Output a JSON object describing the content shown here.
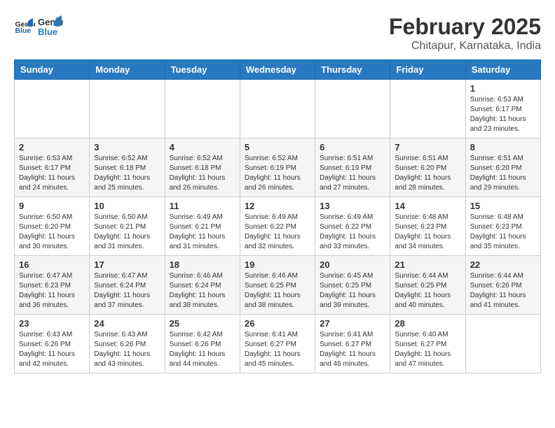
{
  "header": {
    "logo_text_general": "General",
    "logo_text_blue": "Blue",
    "month_year": "February 2025",
    "location": "Chitapur, Karnataka, India"
  },
  "calendar": {
    "days_of_week": [
      "Sunday",
      "Monday",
      "Tuesday",
      "Wednesday",
      "Thursday",
      "Friday",
      "Saturday"
    ],
    "weeks": [
      [
        {
          "day": "",
          "info": ""
        },
        {
          "day": "",
          "info": ""
        },
        {
          "day": "",
          "info": ""
        },
        {
          "day": "",
          "info": ""
        },
        {
          "day": "",
          "info": ""
        },
        {
          "day": "",
          "info": ""
        },
        {
          "day": "1",
          "info": "Sunrise: 6:53 AM\nSunset: 6:17 PM\nDaylight: 11 hours\nand 23 minutes."
        }
      ],
      [
        {
          "day": "2",
          "info": "Sunrise: 6:53 AM\nSunset: 6:17 PM\nDaylight: 11 hours\nand 24 minutes."
        },
        {
          "day": "3",
          "info": "Sunrise: 6:52 AM\nSunset: 6:18 PM\nDaylight: 11 hours\nand 25 minutes."
        },
        {
          "day": "4",
          "info": "Sunrise: 6:52 AM\nSunset: 6:18 PM\nDaylight: 11 hours\nand 26 minutes."
        },
        {
          "day": "5",
          "info": "Sunrise: 6:52 AM\nSunset: 6:19 PM\nDaylight: 11 hours\nand 26 minutes."
        },
        {
          "day": "6",
          "info": "Sunrise: 6:51 AM\nSunset: 6:19 PM\nDaylight: 11 hours\nand 27 minutes."
        },
        {
          "day": "7",
          "info": "Sunrise: 6:51 AM\nSunset: 6:20 PM\nDaylight: 11 hours\nand 28 minutes."
        },
        {
          "day": "8",
          "info": "Sunrise: 6:51 AM\nSunset: 6:20 PM\nDaylight: 11 hours\nand 29 minutes."
        }
      ],
      [
        {
          "day": "9",
          "info": "Sunrise: 6:50 AM\nSunset: 6:20 PM\nDaylight: 11 hours\nand 30 minutes."
        },
        {
          "day": "10",
          "info": "Sunrise: 6:50 AM\nSunset: 6:21 PM\nDaylight: 11 hours\nand 31 minutes."
        },
        {
          "day": "11",
          "info": "Sunrise: 6:49 AM\nSunset: 6:21 PM\nDaylight: 11 hours\nand 31 minutes."
        },
        {
          "day": "12",
          "info": "Sunrise: 6:49 AM\nSunset: 6:22 PM\nDaylight: 11 hours\nand 32 minutes."
        },
        {
          "day": "13",
          "info": "Sunrise: 6:49 AM\nSunset: 6:22 PM\nDaylight: 11 hours\nand 33 minutes."
        },
        {
          "day": "14",
          "info": "Sunrise: 6:48 AM\nSunset: 6:23 PM\nDaylight: 11 hours\nand 34 minutes."
        },
        {
          "day": "15",
          "info": "Sunrise: 6:48 AM\nSunset: 6:23 PM\nDaylight: 11 hours\nand 35 minutes."
        }
      ],
      [
        {
          "day": "16",
          "info": "Sunrise: 6:47 AM\nSunset: 6:23 PM\nDaylight: 11 hours\nand 36 minutes."
        },
        {
          "day": "17",
          "info": "Sunrise: 6:47 AM\nSunset: 6:24 PM\nDaylight: 11 hours\nand 37 minutes."
        },
        {
          "day": "18",
          "info": "Sunrise: 6:46 AM\nSunset: 6:24 PM\nDaylight: 11 hours\nand 38 minutes."
        },
        {
          "day": "19",
          "info": "Sunrise: 6:46 AM\nSunset: 6:25 PM\nDaylight: 11 hours\nand 38 minutes."
        },
        {
          "day": "20",
          "info": "Sunrise: 6:45 AM\nSunset: 6:25 PM\nDaylight: 11 hours\nand 39 minutes."
        },
        {
          "day": "21",
          "info": "Sunrise: 6:44 AM\nSunset: 6:25 PM\nDaylight: 11 hours\nand 40 minutes."
        },
        {
          "day": "22",
          "info": "Sunrise: 6:44 AM\nSunset: 6:26 PM\nDaylight: 11 hours\nand 41 minutes."
        }
      ],
      [
        {
          "day": "23",
          "info": "Sunrise: 6:43 AM\nSunset: 6:26 PM\nDaylight: 11 hours\nand 42 minutes."
        },
        {
          "day": "24",
          "info": "Sunrise: 6:43 AM\nSunset: 6:26 PM\nDaylight: 11 hours\nand 43 minutes."
        },
        {
          "day": "25",
          "info": "Sunrise: 6:42 AM\nSunset: 6:26 PM\nDaylight: 11 hours\nand 44 minutes."
        },
        {
          "day": "26",
          "info": "Sunrise: 6:41 AM\nSunset: 6:27 PM\nDaylight: 11 hours\nand 45 minutes."
        },
        {
          "day": "27",
          "info": "Sunrise: 6:41 AM\nSunset: 6:27 PM\nDaylight: 11 hours\nand 46 minutes."
        },
        {
          "day": "28",
          "info": "Sunrise: 6:40 AM\nSunset: 6:27 PM\nDaylight: 11 hours\nand 47 minutes."
        },
        {
          "day": "",
          "info": ""
        }
      ]
    ]
  }
}
